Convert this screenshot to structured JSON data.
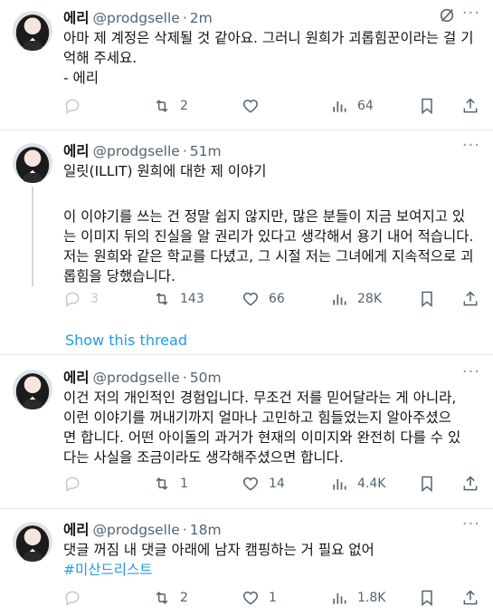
{
  "tweets": [
    {
      "name": "에리",
      "handle": "@prodgselle",
      "time": "2m",
      "lines": [
        "아마 제 계정은 삭제될 것 같아요. 그러니 원희가 괴롭힘꾼이라는 걸 기",
        "억해 주세요.",
        "- 에리"
      ],
      "retweets": "2",
      "likes": "",
      "views": "64"
    },
    {
      "name": "에리",
      "handle": "@prodgselle",
      "time": "51m",
      "lines": [
        "일릿(ILLIT) 원희에 대한 제 이야기",
        "",
        "이 이야기를 쓰는 건 정말 쉽지 않지만, 많은 분들이 지금 보여지고 있",
        "는 이미지 뒤의 진실을 알 권리가 있다고 생각해서 용기 내어 적습니다.",
        "저는 원희와 같은 학교를 다녔고, 그 시절 저는 그녀에게 지속적으로 괴",
        "롭힘을 당했습니다."
      ],
      "replies": "3",
      "retweets": "143",
      "likes": "66",
      "views": "28K"
    },
    {
      "name": "에리",
      "handle": "@prodgselle",
      "time": "50m",
      "lines": [
        "이건 저의 개인적인 경험입니다. 무조건 저를 믿어달라는 게 아니라,",
        "이런 이야기를 꺼내기까지 얼마나 고민하고 힘들었는지 알아주셨으",
        "면 합니다. 어떤 아이돌의 과거가 현재의 이미지와 완전히 다를 수 있",
        "다는 사실을 조금이라도 생각해주셨으면 합니다."
      ],
      "retweets": "1",
      "likes": "14",
      "views": "4.4K"
    },
    {
      "name": "에리",
      "handle": "@prodgselle",
      "time": "18m",
      "lines": [
        "댓글 꺼짐 내 댓글 아래에 남자 캠핑하는 거 필요 없어"
      ],
      "hashtag": "#미산드리스트",
      "retweets": "2",
      "likes": "1",
      "views": "1.8K"
    }
  ],
  "show_thread": "Show this thread",
  "colors": {
    "accent": "#1d9bf0",
    "muted": "#536471",
    "text": "#0f1419",
    "border": "#e6e9ec"
  },
  "icons": [
    "reply-icon",
    "retweet-icon",
    "like-icon",
    "views-icon",
    "bookmark-icon",
    "share-icon",
    "grok-icon",
    "more-icon"
  ]
}
